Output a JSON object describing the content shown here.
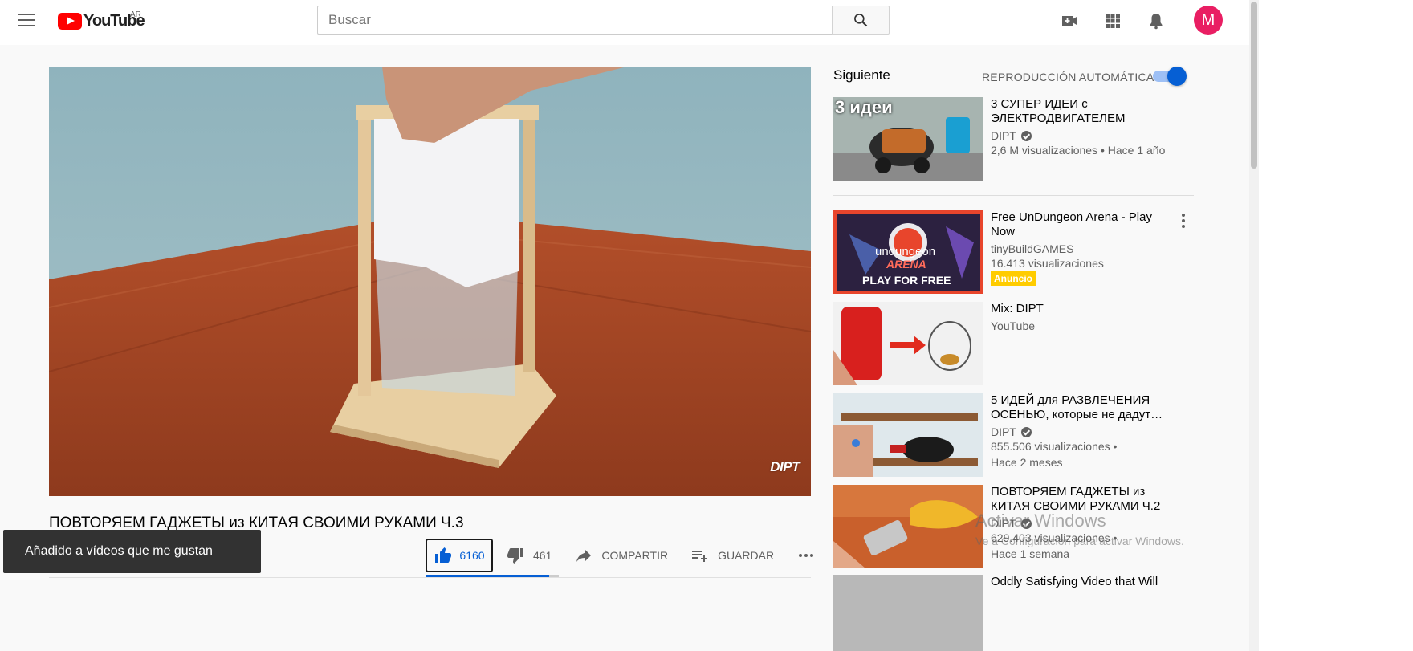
{
  "header": {
    "logo_text": "YouTube",
    "country": "AR",
    "search_placeholder": "Buscar",
    "avatar_letter": "M"
  },
  "video": {
    "watermark": "DIPT",
    "title": "ПОВТОРЯЕМ ГАДЖЕТЫ из КИТАЯ СВОИМИ РУКАМИ Ч.3",
    "likes": "6160",
    "dislikes": "461",
    "share_label": "COMPARTIR",
    "save_label": "GUARDAR",
    "like_ratio": 0.93,
    "partial_views": "0"
  },
  "toast": {
    "message": "Añadido a vídeos que me gustan"
  },
  "sidebar": {
    "up_next": "Siguiente",
    "autoplay_label": "REPRODUCCIÓN AUTOMÁTICA",
    "autoplay_on": true,
    "items": [
      {
        "title": "3 СУПЕР ИДЕИ с ЭЛЕКТРОДВИГАТЕЛЕМ",
        "channel": "DIPT",
        "meta": "2,6 M visualizaciones • Hace 1 año",
        "thumb_text": "3 идеи"
      },
      {
        "title": "Free UnDungeon Arena - Play Now",
        "channel": "tinyBuildGAMES",
        "meta": "16.413 visualizaciones",
        "badge": "Anuncio",
        "thumb_text": "undungeon",
        "thumb_text2": "ARENA",
        "thumb_text3": "PLAY FOR FREE"
      },
      {
        "title": "Mix: DIPT",
        "channel": "YouTube"
      },
      {
        "title": "5 ИДЕЙ для РАЗВЛЕЧЕНИЯ ОСЕНЬЮ, которые не дадут…",
        "channel": "DIPT",
        "meta": "855.506 visualizaciones •",
        "meta2": "Hace 2 meses"
      },
      {
        "title": "ПОВТОРЯЕМ ГАДЖЕТЫ из КИТАЯ СВОИМИ РУКАМИ Ч.2",
        "channel": "DIPT",
        "meta": "629.403 visualizaciones •",
        "meta2": "Hace 1 semana"
      },
      {
        "title": "Oddly Satisfying Video that Will"
      }
    ]
  },
  "windows_overlay": {
    "title": "Activar Windows",
    "subtitle": "Ve a Configuración para activar Windows."
  },
  "colors": {
    "youtube_red": "#ff0000",
    "accent_blue": "#065fd4",
    "avatar": "#e91e63",
    "ad_badge": "#ffcc00"
  }
}
